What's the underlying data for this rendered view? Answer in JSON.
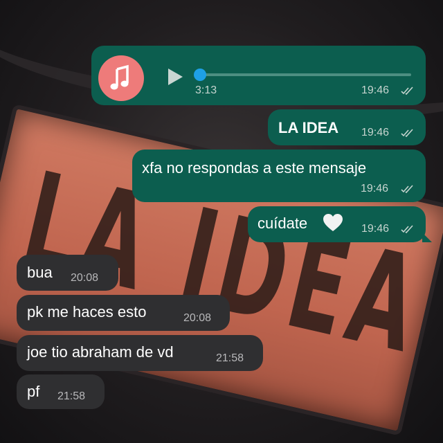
{
  "background": {
    "plate_text": "LA IDEA"
  },
  "audio_message": {
    "duration": "3:13",
    "time": "19:46",
    "progress": 0.0,
    "avatar_icon": "music-note-icon",
    "play_icon": "play-icon",
    "status_icon": "double-check-icon",
    "colors": {
      "avatar": "#ee7b7a",
      "knob": "#1ea0e6"
    }
  },
  "outgoing_messages": [
    {
      "text": "LA IDEA",
      "time": "19:46",
      "bold": true
    },
    {
      "text": "xfa no respondas a este mensaje",
      "time": "19:46"
    },
    {
      "text": "cuídate",
      "emoji": "🤍",
      "time": "19:46"
    }
  ],
  "incoming_messages": [
    {
      "text": "bua",
      "time": "20:08"
    },
    {
      "text": "pk me haces esto",
      "time": "20:08"
    },
    {
      "text": "joe tio abraham de vd",
      "time": "21:58"
    },
    {
      "text": "pf",
      "time": "21:58"
    }
  ],
  "colors": {
    "outgoing_bubble": "#0c5e4f",
    "incoming_bubble": "#2f2f31",
    "read_ticks": "#c6d4cf"
  }
}
